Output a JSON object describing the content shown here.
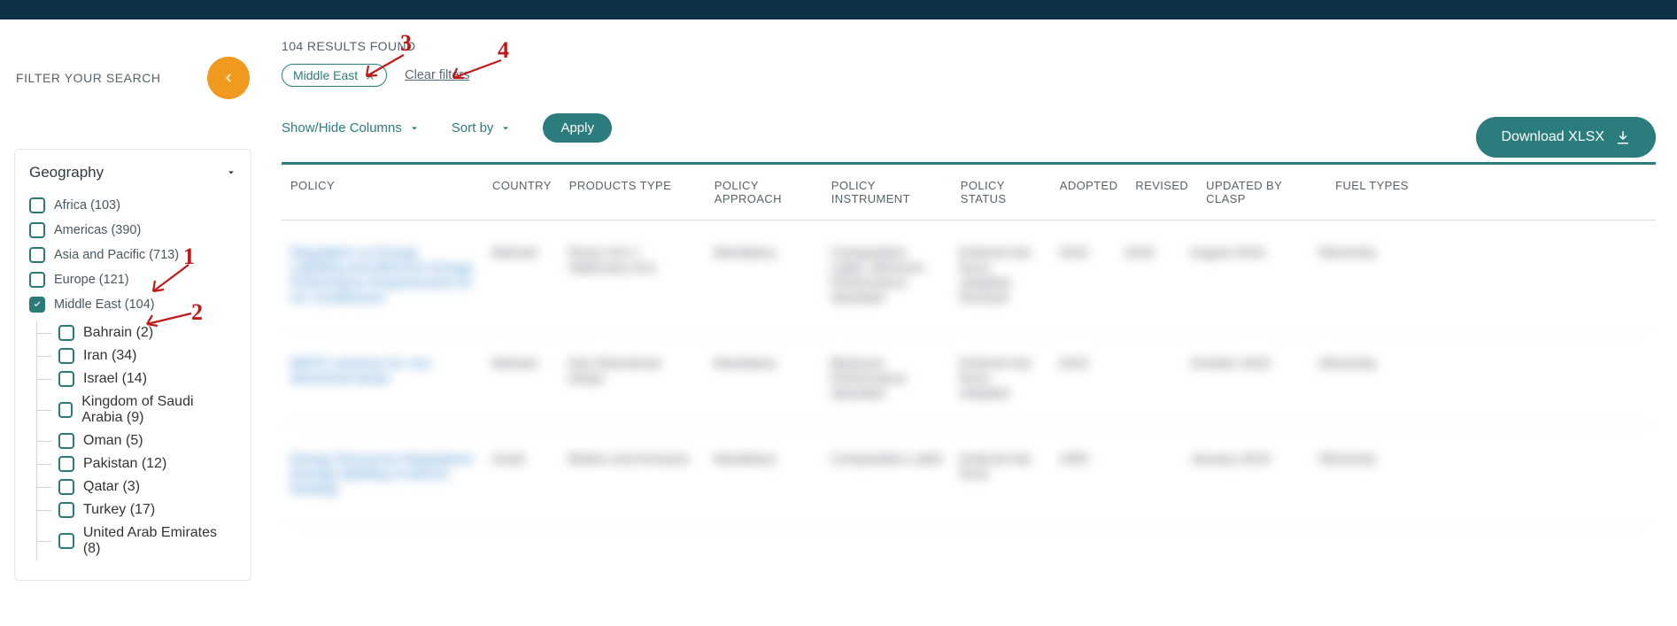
{
  "sidebar": {
    "title": "FILTER YOUR SEARCH",
    "geography": {
      "label": "Geography",
      "items": [
        {
          "label": "Africa (103)",
          "checked": false
        },
        {
          "label": "Americas (390)",
          "checked": false
        },
        {
          "label": "Asia and Pacific (713)",
          "checked": false
        },
        {
          "label": "Europe (121)",
          "checked": false
        },
        {
          "label": "Middle East (104)",
          "checked": true,
          "children": [
            {
              "label": "Bahrain (2)"
            },
            {
              "label": "Iran (34)"
            },
            {
              "label": "Israel (14)"
            },
            {
              "label": "Kingdom of Saudi Arabia (9)"
            },
            {
              "label": "Oman (5)"
            },
            {
              "label": "Pakistan (12)"
            },
            {
              "label": "Qatar (3)"
            },
            {
              "label": "Turkey (17)"
            },
            {
              "label": "United Arab Emirates (8)"
            }
          ]
        }
      ]
    }
  },
  "results": {
    "count_text": "104 RESULTS FOUND",
    "active_filter_chip": "Middle East",
    "clear_filters_label": "Clear filters",
    "show_hide_label": "Show/Hide Columns",
    "sort_by_label": "Sort by",
    "apply_label": "Apply",
    "download_label": "Download XLSX"
  },
  "columns": {
    "policy": "POLICY",
    "country": "COUNTRY",
    "ptype": "PRODUCTS TYPE",
    "approach": "POLICY APPROACH",
    "instrument": "POLICY INSTRUMENT",
    "status": "POLICY STATUS",
    "adopted": "ADOPTED",
    "revised": "REVISED",
    "updated": "UPDATED BY CLASP",
    "fuel": "FUEL TYPES"
  },
  "rows": [
    {
      "policy": "Regulation on Energy Labelling and Minimum Energy Performance Requirements for Air Conditioners",
      "country": "Bahrain",
      "ptype": "Room ACs / Stationary ACs",
      "approach": "Mandatory",
      "instrument": "Comparative Label, Minimum Performance Standard",
      "status": "Entered into force, Adopted, Revised",
      "adopted": "2015",
      "revised": "2019",
      "updated": "August 2019",
      "fuel": "Electricity"
    },
    {
      "policy": "MEPS schemes for non-directional lamps",
      "country": "Bahrain",
      "ptype": "Non-Directional lamps",
      "approach": "Mandatory",
      "instrument": "Minimum Performance Standard",
      "status": "Entered into force, Adopted",
      "adopted": "2015",
      "revised": "",
      "updated": "October 2019",
      "fuel": "Electricity"
    },
    {
      "policy": "Energy Resources Regulations (Energy labelling of electric heating)",
      "country": "Israel",
      "ptype": "Boilers and furnaces",
      "approach": "Mandatory",
      "instrument": "Comparative Label",
      "status": "Entered into force",
      "adopted": "1993",
      "revised": "",
      "updated": "January 2019",
      "fuel": "Electricity"
    }
  ],
  "annotations": {
    "n1": "1",
    "n2": "2",
    "n3": "3",
    "n4": "4"
  }
}
